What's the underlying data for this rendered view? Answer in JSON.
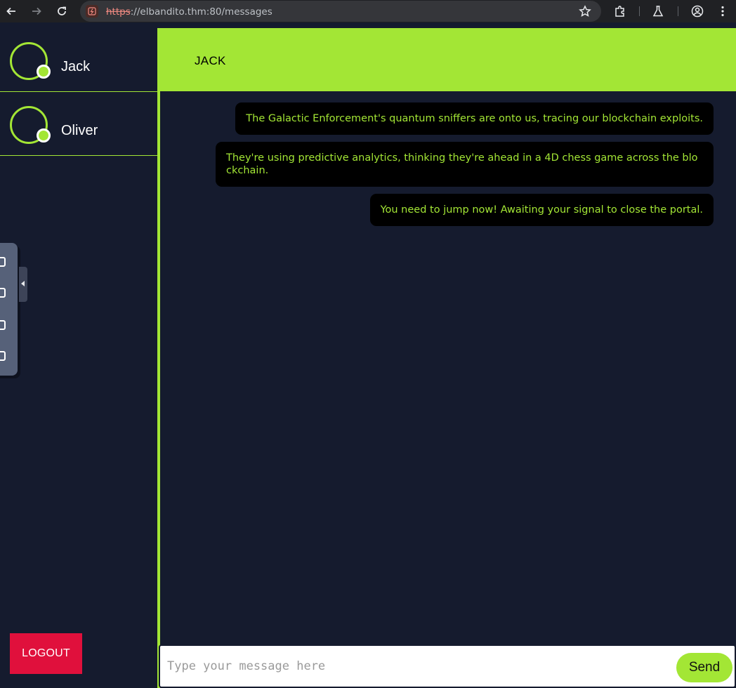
{
  "browser": {
    "url_scheme": "https",
    "url_rest": "://elbandito.thm:80/messages"
  },
  "sidebar": {
    "contacts": [
      {
        "name": "Jack"
      },
      {
        "name": "Oliver"
      }
    ],
    "logout_label": "LOGOUT"
  },
  "chat": {
    "title": "JACK",
    "messages": [
      {
        "text": "The Galactic Enforcement's quantum sniffers are onto us, tracing our blockchain exploits."
      },
      {
        "text": "They're using predictive analytics, thinking they're ahead in a 4D chess game across the blockchain."
      },
      {
        "text": "You need to jump now! Awaiting your signal to close the portal."
      }
    ],
    "input_placeholder": "Type your message here",
    "send_label": "Send"
  },
  "colors": {
    "accent": "#a3e635",
    "background": "#151b2e",
    "bubble": "#000000",
    "logout": "#e0103c"
  }
}
